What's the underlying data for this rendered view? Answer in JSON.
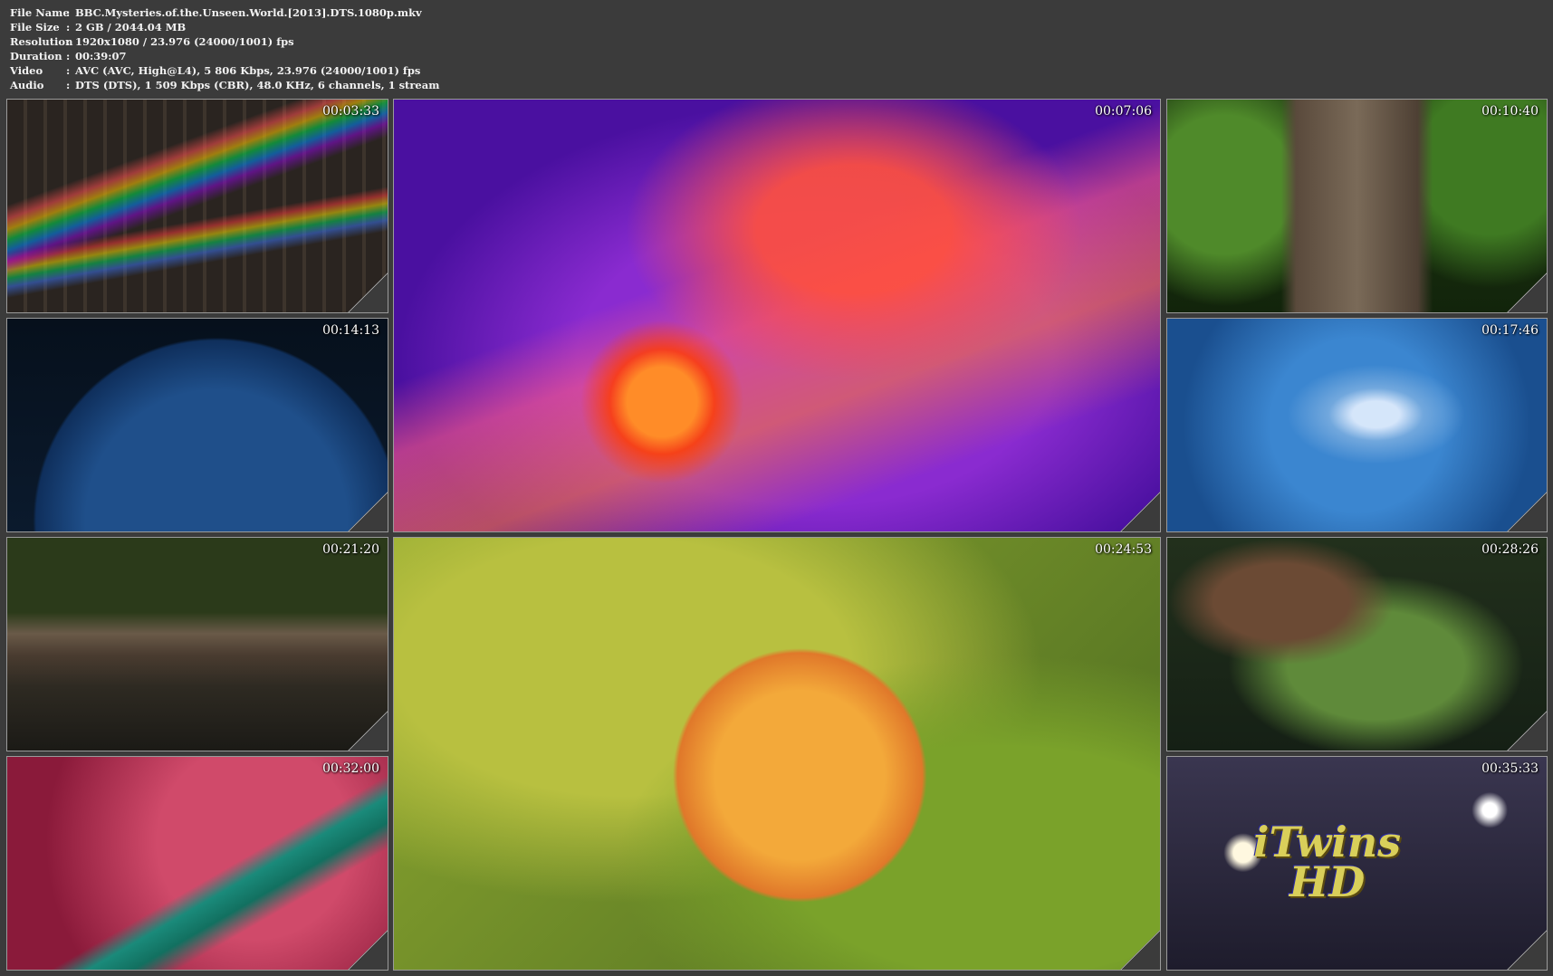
{
  "file_info": {
    "rows": [
      {
        "label": "File Name",
        "value": "BBC.Mysteries.of.the.Unseen.World.[2013].DTS.1080p.mkv"
      },
      {
        "label": "File Size",
        "value": "2 GB  / 2044.04 MB"
      },
      {
        "label": "Resolution",
        "value": "1920x1080 / 23.976 (24000/1001) fps"
      },
      {
        "label": "Duration",
        "value": "00:39:07"
      },
      {
        "label": "Video",
        "value": "AVC (AVC, High@L4), 5 806 Kbps, 23.976 (24000/1001) fps"
      },
      {
        "label": "Audio",
        "value": "DTS (DTS), 1 509 Kbps (CBR), 48.0 KHz, 6 channels, 1 stream"
      }
    ]
  },
  "thumbnails": [
    {
      "timestamp": "00:03:33"
    },
    {
      "timestamp": "00:07:06"
    },
    {
      "timestamp": "00:10:40"
    },
    {
      "timestamp": "00:14:13"
    },
    {
      "timestamp": "00:17:46"
    },
    {
      "timestamp": "00:21:20"
    },
    {
      "timestamp": "00:24:53"
    },
    {
      "timestamp": "00:28:26"
    },
    {
      "timestamp": "00:32:00"
    },
    {
      "timestamp": "00:35:33"
    }
  ],
  "watermark": {
    "line1": "iTwins",
    "line2": "HD"
  }
}
